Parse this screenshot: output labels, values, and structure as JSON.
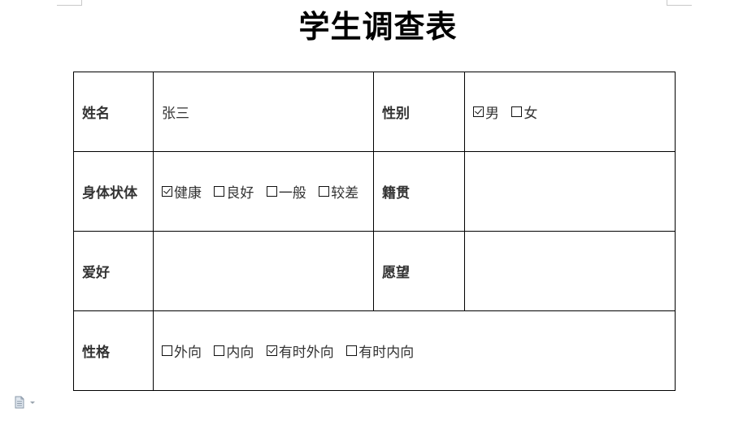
{
  "document": {
    "title": "学生调查表"
  },
  "form": {
    "name": {
      "label": "姓名",
      "value": "张三"
    },
    "gender": {
      "label": "性别",
      "options": [
        {
          "label": "男",
          "checked": true
        },
        {
          "label": "女",
          "checked": false
        }
      ]
    },
    "health": {
      "label": "身体状体",
      "options": [
        {
          "label": "健康",
          "checked": true
        },
        {
          "label": "良好",
          "checked": false
        },
        {
          "label": "一般",
          "checked": false
        },
        {
          "label": "较差",
          "checked": false
        }
      ]
    },
    "hometown": {
      "label": "籍贯",
      "value": ""
    },
    "hobby": {
      "label": "爱好",
      "value": ""
    },
    "wish": {
      "label": "愿望",
      "value": ""
    },
    "personality": {
      "label": "性格",
      "options": [
        {
          "label": "外向",
          "checked": false
        },
        {
          "label": "内向",
          "checked": false
        },
        {
          "label": "有时外向",
          "checked": true
        },
        {
          "label": "有时内向",
          "checked": false
        }
      ]
    }
  },
  "icons": {
    "margin_icon": "document-icon"
  }
}
